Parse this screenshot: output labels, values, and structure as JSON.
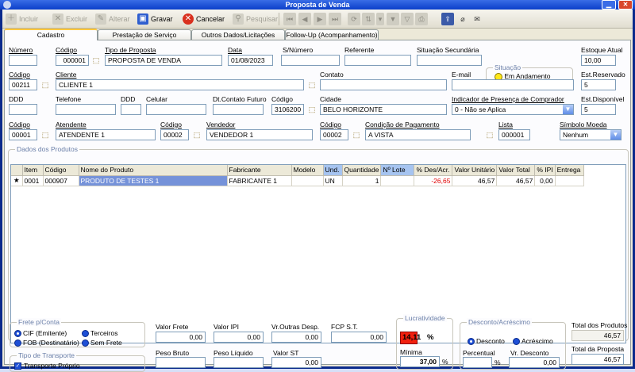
{
  "window": {
    "title": "Proposta de Venda"
  },
  "toolbar": {
    "incluir": "Incluir",
    "excluir": "Excluir",
    "alterar": "Alterar",
    "gravar": "Gravar",
    "cancelar": "Cancelar",
    "pesquisar": "Pesquisar"
  },
  "tabs": [
    "Cadastro",
    "Prestação de Serviço",
    "Outros Dados/Licitações",
    "Follow-Up (Acompanhamento)"
  ],
  "form": {
    "numero_label": "Número",
    "numero": "",
    "codigo_label": "Código",
    "codigo": "000001",
    "tipo_label": "Tipo de Proposta",
    "tipo": "PROPOSTA DE VENDA",
    "data_label": "Data",
    "data": "01/08/2023",
    "snumero_label": "S/Número",
    "snumero": "",
    "referente_label": "Referente",
    "referente": "",
    "sit_sec_label": "Situação Secundária",
    "sit_sec": "",
    "situacao_label": "Situação",
    "situacao": "Em Andamento",
    "estoque_label": "Estoque Atual",
    "estoque": "10,00",
    "cli_cod_label": "Código",
    "cli_cod": "00211",
    "cliente_label": "Cliente",
    "cliente": "CLIENTE 1",
    "contato_label": "Contato",
    "contato": "",
    "email_label": "E-mail",
    "email": "",
    "est_res_label": "Est.Reservado",
    "est_res": "5",
    "ddd_label": "DDD",
    "ddd": "",
    "telefone_label": "Telefone",
    "telefone": "",
    "ddd2_label": "DDD",
    "ddd2": "",
    "celular_label": "Celular",
    "celular": "",
    "dt_contato_label": "Dt.Contato Futuro",
    "dt_contato": "",
    "cid_cod_label": "Código",
    "cid_cod": "3106200",
    "cidade_label": "Cidade",
    "cidade": "BELO HORIZONTE",
    "indicador_label": "Indicador de Presença de Comprador",
    "indicador": "0 - Não se Aplica",
    "est_disp_label": "Est.Disponível",
    "est_disp": "5",
    "at_cod_label": "Código",
    "at_cod": "00001",
    "atendente_label": "Atendente",
    "atendente": "ATENDENTE 1",
    "ven_cod_label": "Código",
    "ven_cod": "00002",
    "vendedor_label": "Vendedor",
    "vendedor": "VENDEDOR 1",
    "cp_cod_label": "Código",
    "cp_cod": "00002",
    "condicao_label": "Condição de Pagamento",
    "condicao": "A VISTA",
    "lista_label": "Lista",
    "lista": "000001",
    "simbolo_label": "Símbolo Moeda",
    "simbolo": "Nenhum"
  },
  "produtos": {
    "legend": "Dados dos Produtos",
    "headers": [
      "Item",
      "Código",
      "Nome do Produto",
      "Fabricante",
      "Modelo",
      "Und.",
      "Quantidade",
      "Nº Lote",
      "% Des/Acr.",
      "Valor Unitário",
      "Valor Total",
      "% IPI",
      "Entrega"
    ],
    "rows": [
      {
        "marker": "★",
        "item": "0001",
        "codigo": "000907",
        "nome": "PRODUTO DE TESTES 1",
        "fabricante": "FABRICANTE 1",
        "modelo": "",
        "und": "UN",
        "quantidade": "1",
        "lote": "",
        "desacr": "-26,65",
        "unitario": "46,57",
        "total": "46,57",
        "ipi": "0,00",
        "entrega": ""
      }
    ]
  },
  "footer": {
    "frete_legend": "Frete p/Conta",
    "frete_cif": "CIF (Emitente)",
    "frete_terceiros": "Terceiros",
    "frete_fob": "FOB (Destinatário)",
    "frete_sem": "Sem Frete",
    "transporte_legend": "Tipo de Transporte",
    "transporte": "Transporte Próprio",
    "valor_frete_label": "Valor Frete",
    "valor_frete": "0,00",
    "valor_ipi_label": "Valor IPI",
    "valor_ipi": "0,00",
    "outras_label": "Vr.Outras Desp.",
    "outras": "0,00",
    "fcp_label": "FCP S.T.",
    "fcp": "0,00",
    "peso_bruto_label": "Peso Bruto",
    "peso_bruto": "",
    "peso_liq_label": "Peso Líquido",
    "peso_liq": "",
    "valor_st_label": "Valor ST",
    "valor_st": "0,00",
    "lucr_legend": "Lucratividade",
    "lucr": "14,11",
    "lucr_pct": "%",
    "minima_label": "Mínima",
    "minima": "37,00",
    "minima_pct": "%",
    "desc_legend": "Desconto/Acréscimo",
    "desconto": "Desconto",
    "acrescimo": "Acréscimo",
    "percentual_label": "Percentual",
    "percentual": "",
    "percentual_pct": "%",
    "vr_desc_label": "Vr. Desconto",
    "vr_desc": "0,00",
    "total_prod_label": "Total dos Produtos",
    "total_prod": "46,57",
    "total_prop_label": "Total da Proposta",
    "total_prop": "46,57"
  }
}
